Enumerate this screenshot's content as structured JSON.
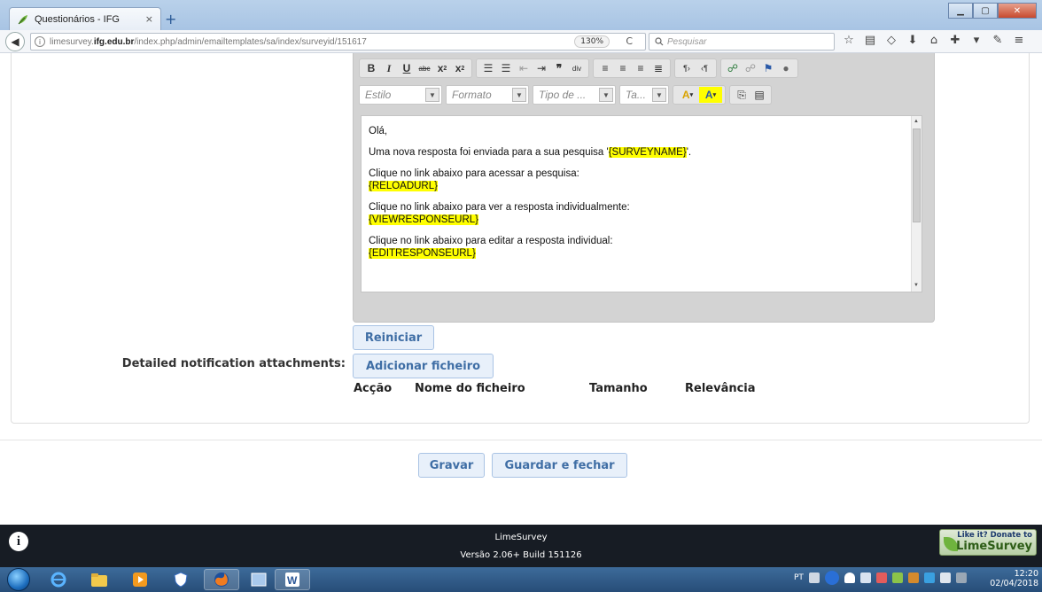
{
  "browser": {
    "tab_title": "Questionários - IFG",
    "tab_close": "×",
    "new_tab": "+",
    "url_prefix": "limesurvey.",
    "url_domain": "ifg.edu.br",
    "url_path": "/index.php/admin/emailtemplates/sa/index/surveyid/151617",
    "zoom": "130%",
    "search_placeholder": "Pesquisar"
  },
  "editor": {
    "dropdowns": {
      "style": "Estilo",
      "format": "Formato",
      "font": "Tipo de ...",
      "size": "Ta..."
    },
    "content": {
      "greeting": "Olá,",
      "line1_prefix": "Uma nova resposta foi enviada para a sua pesquisa '",
      "line1_var": "{SURVEYNAME}",
      "line1_suffix": "'.",
      "line2": "Clique no link abaixo para acessar a pesquisa:",
      "line2_var": "{RELOADURL}",
      "line3": "Clique no link abaixo para ver a resposta individualmente:",
      "line3_var": "{VIEWRESPONSEURL}",
      "line4": "Clique no link abaixo para editar a resposta individual:",
      "line4_var": "{EDITRESPONSEURL}"
    }
  },
  "form": {
    "reset_button": "Reiniciar",
    "attachments_label": "Detailed notification attachments:",
    "add_file_button": "Adicionar ficheiro",
    "columns": [
      "Acção",
      "Nome do ficheiro",
      "Tamanho",
      "Relevância"
    ],
    "save_button": "Gravar",
    "save_close_button": "Guardar e fechar"
  },
  "footer": {
    "name": "LimeSurvey",
    "version": "Versão 2.06+ Build 151126",
    "donate_top": "Like it? Donate to",
    "donate_bottom": "LimeSurvey"
  },
  "taskbar": {
    "lang": "PT",
    "time": "12:20",
    "date": "02/04/2018"
  }
}
